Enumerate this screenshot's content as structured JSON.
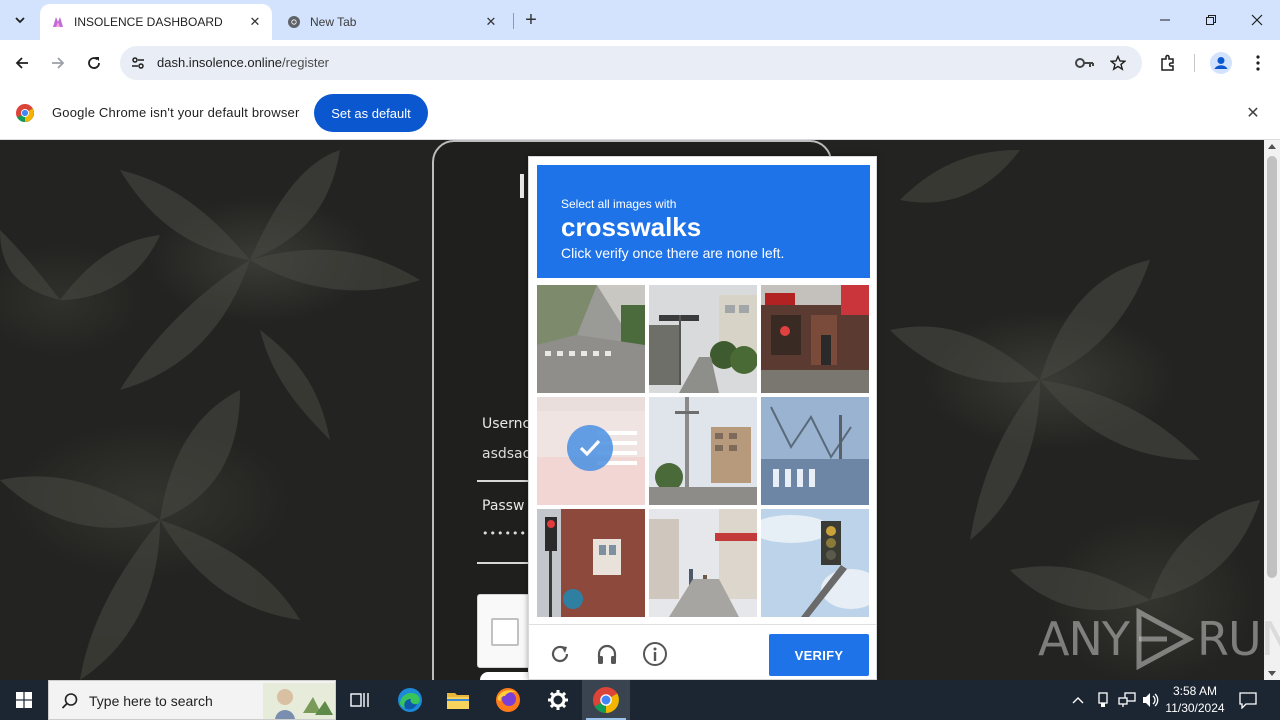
{
  "browser": {
    "tabs": [
      {
        "title": "INSOLENCE DASHBOARD",
        "active": true
      },
      {
        "title": "New Tab",
        "active": false
      }
    ],
    "url_host": "dash.insolence.online",
    "url_path": "/register"
  },
  "infobar": {
    "message": "Google Chrome isn't your default browser",
    "button_label": "Set as default"
  },
  "page": {
    "username_label": "Usernc",
    "username_value": "asdsac",
    "password_label": "Passw",
    "password_value": "••••••••"
  },
  "challenge": {
    "prompt_small": "Select all images with",
    "prompt_big": "crosswalks",
    "prompt_sub": "Click verify once there are none left.",
    "verify_label": "VERIFY",
    "tiles_selected": [
      false,
      false,
      false,
      true,
      false,
      false,
      false,
      false,
      false
    ]
  },
  "watermark": {
    "left": "ANY",
    "right": "RUN"
  },
  "taskbar": {
    "search_placeholder": "Type here to search",
    "time": "3:58 AM",
    "date": "11/30/2024"
  },
  "colors": {
    "accent": "#1e73e8",
    "chrome_blue": "#0b57d0",
    "tabstrip": "#d3e3fd"
  }
}
